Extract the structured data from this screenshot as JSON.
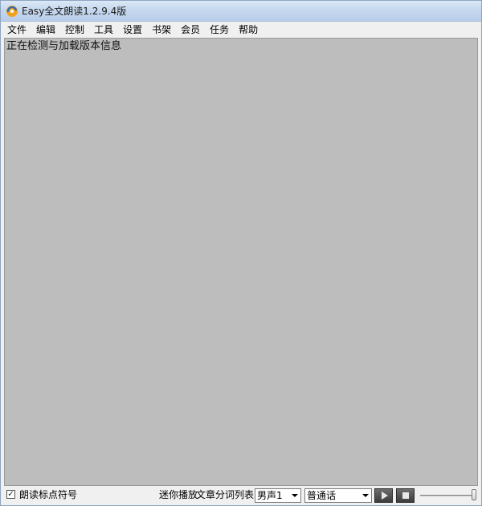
{
  "window": {
    "title": "Easy全文朗读1.2.9.4版",
    "app_icon": "app-logo-icon"
  },
  "menu": {
    "items": [
      {
        "label": "文件"
      },
      {
        "label": "编辑"
      },
      {
        "label": "控制"
      },
      {
        "label": "工具"
      },
      {
        "label": "设置"
      },
      {
        "label": "书架"
      },
      {
        "label": "会员"
      },
      {
        "label": "任务"
      },
      {
        "label": "帮助"
      }
    ]
  },
  "content": {
    "text": "正在检测与加载版本信息"
  },
  "bottom": {
    "read_punctuation_label": "朗读标点符号",
    "read_punctuation_checked": true,
    "mini_player_label": "迷你播放",
    "segment_list_label": "文章分词列表",
    "voice_select": {
      "value": "男声1"
    },
    "dialect_select": {
      "value": "普通话"
    },
    "play_icon": "play-icon",
    "stop_icon": "stop-icon",
    "volume_level": 1.0
  },
  "colors": {
    "content_background": "#bdbdbd",
    "window_background": "#f0f0f0",
    "titlebar": "#c6d8ee"
  }
}
